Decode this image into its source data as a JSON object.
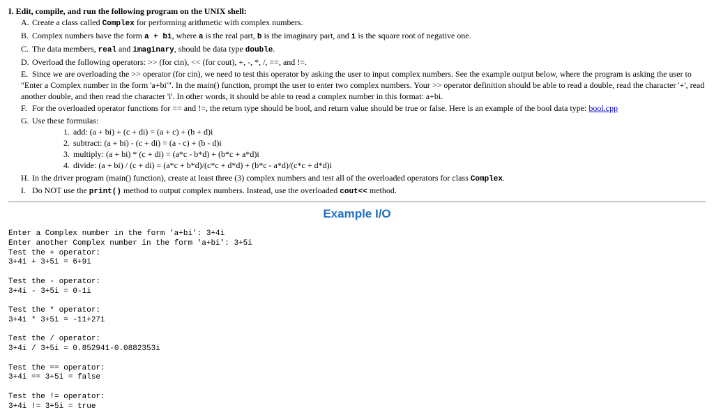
{
  "heading": "I. Edit, compile, and run the following program on the UNIX shell:",
  "items": {
    "A": {
      "lbl": "A.",
      "prefix": "Create a class called ",
      "c1": "Complex",
      "suffix": " for performing arithmetic with complex numbers."
    },
    "B": {
      "lbl": "B.",
      "t1": "Complex numbers have the form ",
      "c1": "a + bi",
      "t2": ", where ",
      "c2": "a",
      "t3": " is the real part, ",
      "c3": "b",
      "t4": " is the imaginary part, and ",
      "c4": "i",
      "t5": " is the square root of negative one."
    },
    "C": {
      "lbl": "C.",
      "t1": "The data members, ",
      "c1": "real",
      "t2": " and ",
      "c2": "imaginary",
      "t3": ", should be data type ",
      "c3": "double",
      "t4": "."
    },
    "D": {
      "lbl": "D.",
      "text": "Overload the following operators: >> (for cin), << (for cout), +, -, *, /, ==, and !=."
    },
    "E": {
      "lbl": "E.",
      "text": "Since we are overloading the >> operator (for cin), we need to test this operator by asking the user to input complex numbers. See the example output below, where the program is asking the user to \"Enter a Complex number in the form 'a+bi'\". In the main() function, prompt the user to enter two complex numbers. Your >> operator definition should be able to read a double, read the character '+', read another double, and then read the character 'i'. In other words, it should be able to read a complex number in this format: a+bi."
    },
    "F": {
      "lbl": "F.",
      "t1": "For the overloaded operator functions for == and !=, the return type should be bool, and return value should be true or false. Here is an example of the bool data type: ",
      "link": "bool.cpp"
    },
    "G": {
      "lbl": "G.",
      "text": "Use these formulas:"
    },
    "H": {
      "lbl": "H.",
      "t1": "In the driver program (main() function), create at least three (3) complex numbers and test all of the overloaded operators for class ",
      "c1": "Complex",
      "t2": "."
    },
    "I": {
      "lbl": "I.",
      "t1": "Do NOT use the ",
      "c1": "print()",
      "t2": " method to output complex numbers. Instead, use the overloaded ",
      "c2": "cout<<",
      "t3": " method."
    }
  },
  "formulas": {
    "f1": {
      "n": "1.",
      "text": "add: (a + bi) + (c + di) = (a + c) + (b + d)i"
    },
    "f2": {
      "n": "2.",
      "text": "subtract: (a + bi) - (c + di) = (a - c) + (b - d)i"
    },
    "f3": {
      "n": "3.",
      "text": "multiply: (a + bi) * (c + di) = (a*c - b*d) + (b*c + a*d)i"
    },
    "f4": {
      "n": "4.",
      "text": "divide: (a + bi) / (c + di) = (a*c + b*d)/(c*c + d*d) + (b*c - a*d)/(c*c + d*d)i"
    }
  },
  "example": {
    "title": "Example I/O",
    "io": "Enter a Complex number in the form 'a+bi': 3+4i\nEnter another Complex number in the form 'a+bi': 3+5i\nTest the + operator:\n3+4i + 3+5i = 6+9i\n\nTest the - operator:\n3+4i - 3+5i = 0-1i\n\nTest the * operator:\n3+4i * 3+5i = -11+27i\n\nTest the / operator:\n3+4i / 3+5i = 0.852941-0.0882353i\n\nTest the == operator:\n3+4i == 3+5i = false\n\nTest the != operator:\n3+4i != 3+5i = true"
  }
}
